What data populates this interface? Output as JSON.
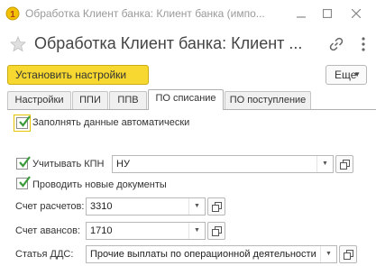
{
  "window": {
    "title": "Обработка Клиент банка: Клиент банка (импо...",
    "buttons": [
      "minimize-icon",
      "maximize-icon",
      "close-icon"
    ]
  },
  "form": {
    "title": "Обработка Клиент банка: Клиент ...",
    "icons": [
      "star-icon",
      "link-icon",
      "more-vertical-icon"
    ]
  },
  "toolbar": {
    "apply_label": "Установить настройки",
    "more_label": "Еще"
  },
  "tabs": [
    {
      "label": "Настройки",
      "active": false
    },
    {
      "label": "ППИ",
      "active": false
    },
    {
      "label": "ППВ",
      "active": false
    },
    {
      "label": "ПО списание",
      "active": true
    },
    {
      "label": "ПО поступление",
      "active": false
    }
  ],
  "settings": {
    "fill_auto": {
      "label": "Заполнять данные автоматически",
      "checked": true
    },
    "kpn": {
      "label": "Учитывать КПН",
      "checked": true,
      "value": "НУ"
    },
    "post_new": {
      "label": "Проводить новые документы",
      "checked": true
    },
    "settlement_account": {
      "label": "Счет расчетов:",
      "value": "3310"
    },
    "advance_account": {
      "label": "Счет авансов:",
      "value": "1710"
    },
    "cash_flow_item": {
      "label": "Статья ДДС:",
      "value": "Прочие выплаты по операционной деятельности"
    }
  },
  "colors": {
    "accent_button": "#f7d830",
    "check_mark": "#3a9b3a",
    "focus_frame": "#e6c200"
  }
}
